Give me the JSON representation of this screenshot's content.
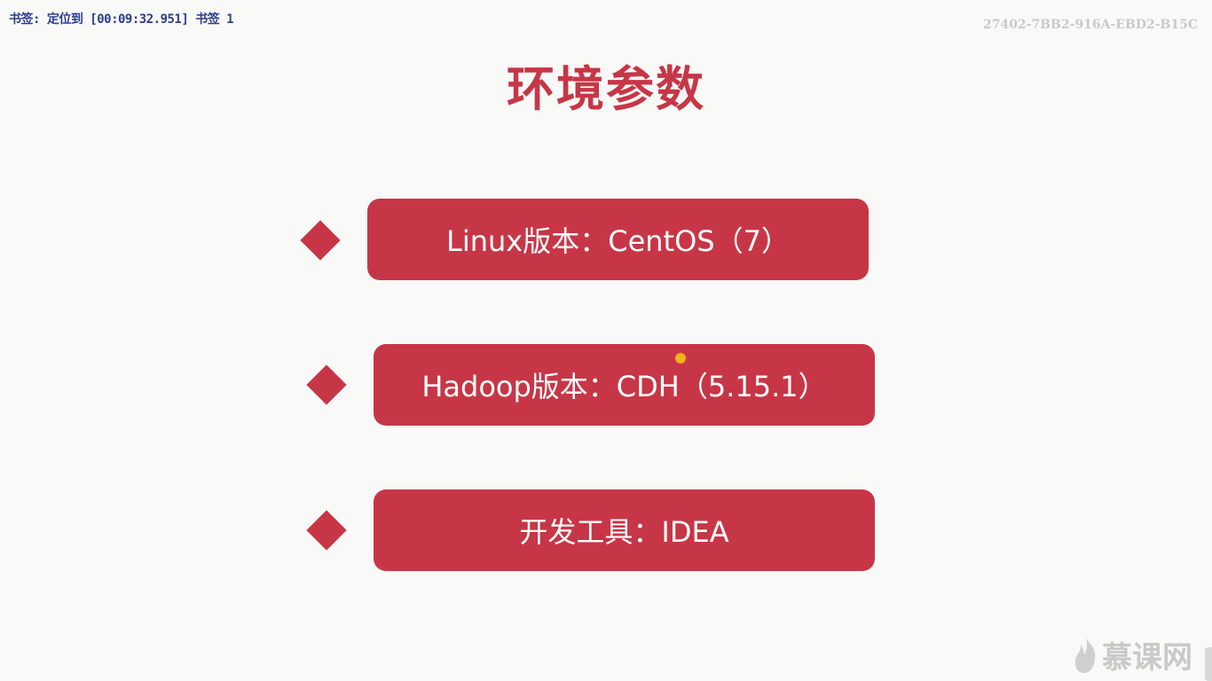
{
  "overlay": {
    "bookmark_text": "书签: 定位到 [00:09:32.951] 书签 1",
    "serial_text": "27402-7BB2-916A-EBD2-B15C"
  },
  "slide": {
    "title": "环境参数",
    "items": [
      {
        "label": "Linux版本：CentOS（7）"
      },
      {
        "label": "Hadoop版本：CDH（5.15.1）"
      },
      {
        "label": "开发工具：IDEA"
      }
    ]
  },
  "watermark": {
    "logo_text": "慕课网",
    "logo_icon": "flame-icon"
  },
  "colors": {
    "accent": "#c73646",
    "background": "#f9f9f8",
    "bookmark_text": "#2d3e8f",
    "watermark": "#c9c9c9",
    "cursor": "#f2b21a"
  }
}
